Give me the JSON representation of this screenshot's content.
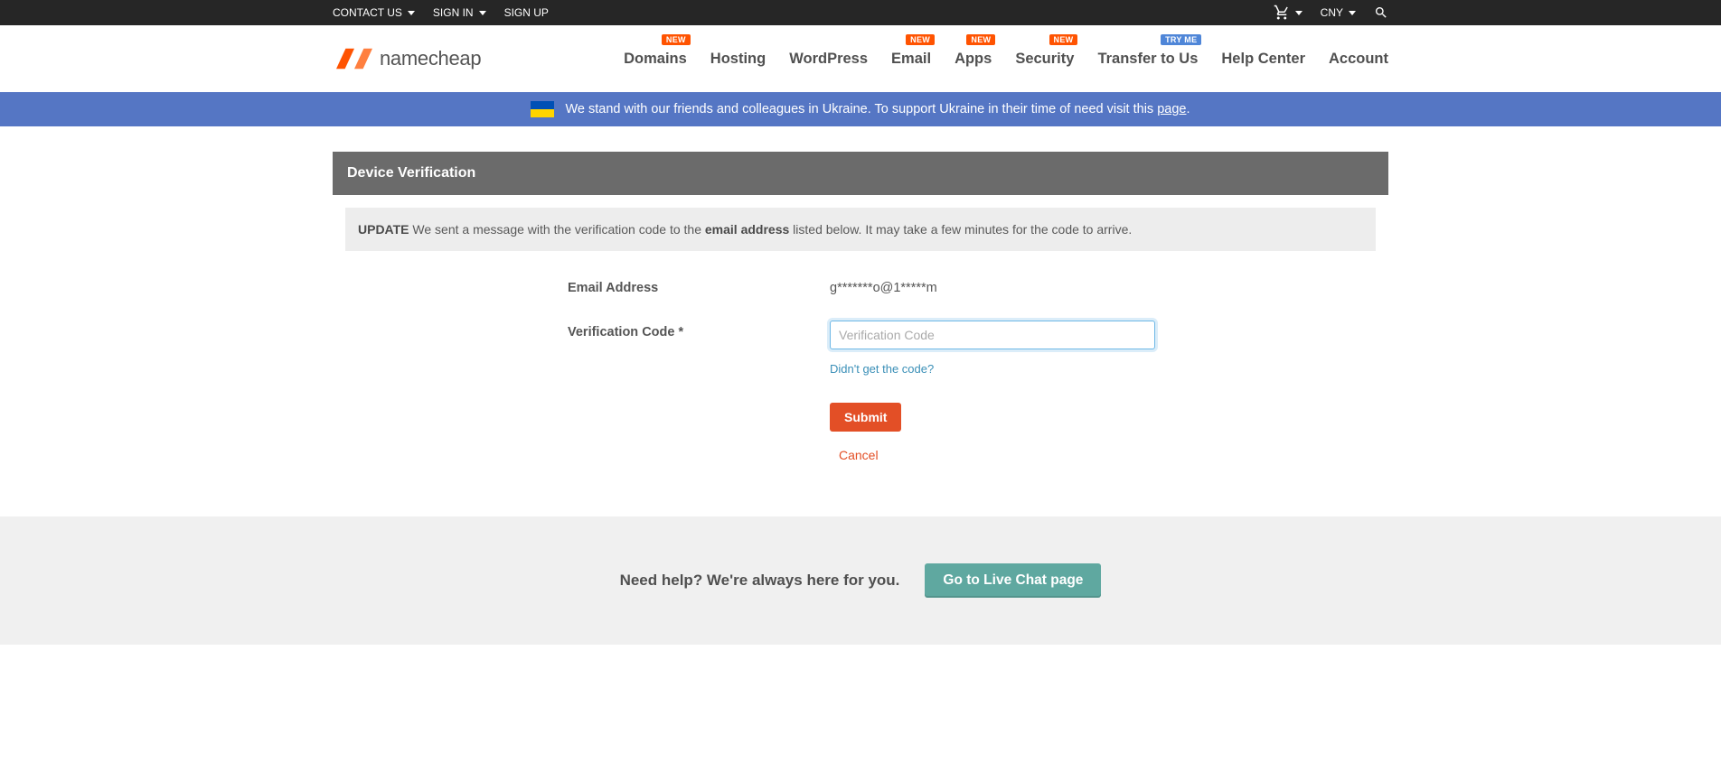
{
  "topbar": {
    "contact": "CONTACT US",
    "signin": "SIGN IN",
    "signup": "SIGN UP",
    "currency": "CNY"
  },
  "logo": {
    "text": "namecheap"
  },
  "nav": {
    "domains": "Domains",
    "hosting": "Hosting",
    "wordpress": "WordPress",
    "email": "Email",
    "apps": "Apps",
    "security": "Security",
    "transfer": "Transfer to Us",
    "help": "Help Center",
    "account": "Account",
    "badge_new": "NEW",
    "badge_try": "TRY ME"
  },
  "banner": {
    "text_before": "We stand with our friends and colleagues in Ukraine. To support Ukraine in their time of need visit this ",
    "link": "page",
    "text_after": "."
  },
  "panel": {
    "title": "Device Verification"
  },
  "update": {
    "label": "UPDATE",
    "text_before": " We sent a message with the verification code to the ",
    "bold": "email address",
    "text_after": " listed below. It may take a few minutes for the code to arrive."
  },
  "form": {
    "email_label": "Email Address",
    "email_value": "g*******o@1*****m",
    "code_label": "Verification Code *",
    "code_placeholder": "Verification Code",
    "resend": "Didn't get the code?",
    "submit": "Submit",
    "cancel": "Cancel"
  },
  "footer": {
    "help_text": "Need help? We're always here for you.",
    "chat_button": "Go to Live Chat page"
  }
}
